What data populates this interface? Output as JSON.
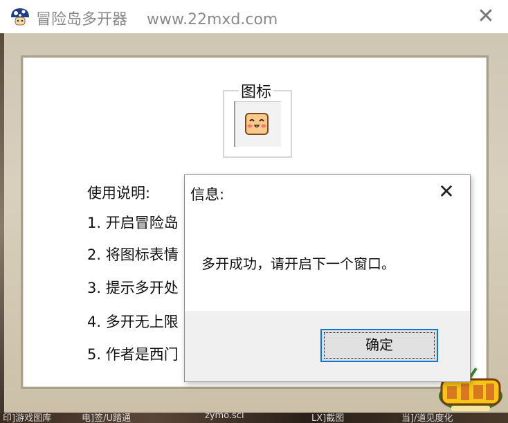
{
  "window": {
    "title": "冒险岛多开器",
    "url": "www.22mxd.com",
    "close_glyph": "✕"
  },
  "icon_group": {
    "legend": "图标",
    "icon": "cute-face-icon"
  },
  "instructions": {
    "heading": "使用说明:",
    "items": [
      "1. 开启冒险岛",
      "2. 将图标表情",
      "3. 提示多开处",
      "4. 多开无上限",
      "5. 作者是西门"
    ]
  },
  "dialog": {
    "title": "信息:",
    "close_glyph": "✕",
    "message": "多开成功，请开启下一个窗口。",
    "ok_label": "确定"
  },
  "bottom_strip": {
    "fragments": [
      "印]游戏图库",
      "电]签/U踏通",
      "zymo.scl",
      "LX]截图",
      "当]/道见度化"
    ]
  },
  "colors": {
    "focus_blue": "#0078d7",
    "title_gray": "#8a8a8a",
    "panel_border": "#a89f8c"
  }
}
